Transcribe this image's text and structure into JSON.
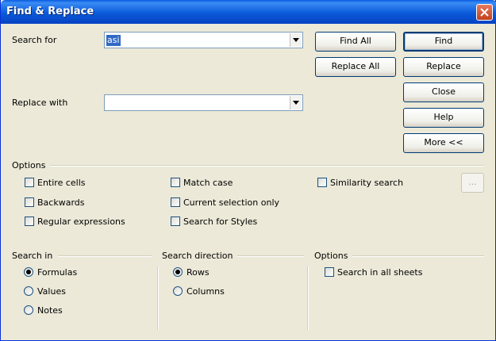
{
  "window": {
    "title": "Find & Replace"
  },
  "search_for": {
    "label": "Search for",
    "value": "asi"
  },
  "replace_with": {
    "label": "Replace with",
    "value": ""
  },
  "buttons": {
    "find_all": "Find All",
    "find": "Find",
    "replace_all": "Replace All",
    "replace": "Replace",
    "close": "Close",
    "help": "Help",
    "more": "More <<",
    "attributes": "..."
  },
  "options": {
    "label": "Options",
    "entire_cells": "Entire cells",
    "backwards": "Backwards",
    "regular_expressions": "Regular expressions",
    "match_case": "Match case",
    "current_selection_only": "Current selection only",
    "search_for_styles": "Search for Styles",
    "similarity_search": "Similarity search"
  },
  "search_in": {
    "label": "Search in",
    "items": [
      "Formulas",
      "Values",
      "Notes"
    ],
    "selected": "Formulas"
  },
  "search_direction": {
    "label": "Search direction",
    "items": [
      "Rows",
      "Columns"
    ],
    "selected": "Rows"
  },
  "options2": {
    "label": "Options",
    "search_all_sheets": "Search in all sheets"
  },
  "colors": {
    "title_bar": "#0a5ce0",
    "selection": "#316ac5",
    "dialog_bg": "#ece9d8"
  }
}
